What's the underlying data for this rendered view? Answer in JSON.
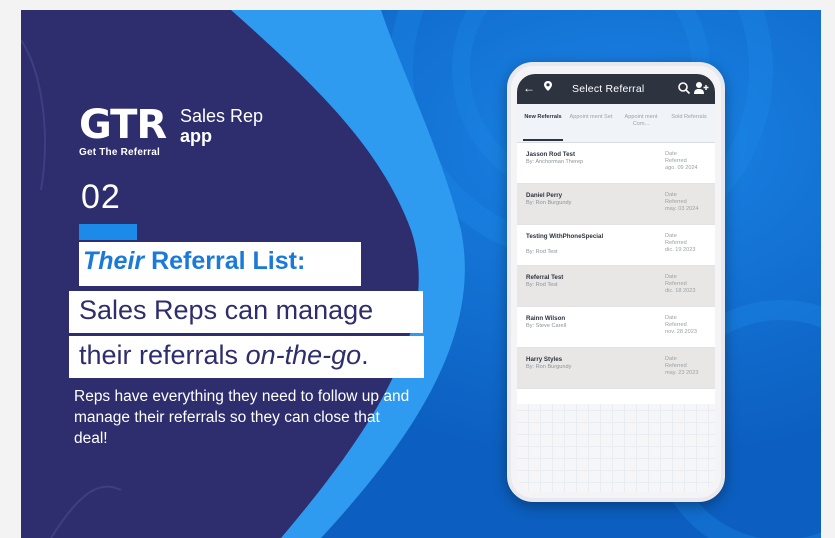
{
  "logo": {
    "mark": "GTR",
    "tagline": "Get The Referral"
  },
  "app_title": {
    "line1": "Sales Rep",
    "line2": "app"
  },
  "feature_number": "02",
  "headline": {
    "line1_italic": "Their",
    "line1_rest": " Referral List:",
    "line2": "Sales Reps can manage",
    "line3_start": "their referrals ",
    "line3_italic": "on-the-go",
    "line3_end": "."
  },
  "description": "Reps have everything they need to follow up and manage their referrals so they can close that deal!",
  "phone": {
    "title": "Select Referral",
    "tabs": [
      {
        "label": "New Referrals",
        "active": true
      },
      {
        "label": "Appoint ment Set",
        "active": false
      },
      {
        "label": "Appoint ment Com...",
        "active": false
      },
      {
        "label": "Sold Referrals",
        "active": false
      }
    ],
    "date_label": "Date",
    "date_sublabel": "Referred",
    "referrals": [
      {
        "name": "Jasson Rod Test",
        "by": "By: Anchorman Therep",
        "date": "ago. 09 2024"
      },
      {
        "name": "Daniel Perry",
        "by": "By: Ron Burgundy",
        "date": "may. 03 2024"
      },
      {
        "name": "Testing WithPhoneSpecial",
        "by": "By: Rod Test",
        "date": "dic. 19 2023"
      },
      {
        "name": "Referral Test",
        "by": "By: Rod Test",
        "date": "dic. 18 2023"
      },
      {
        "name": "Rainn Wilson",
        "by": "By: Steve Carell",
        "date": "nov. 28 2023"
      },
      {
        "name": "Harry Styles",
        "by": "By: Ron Burgundy",
        "date": "may. 23 2023"
      }
    ]
  },
  "colors": {
    "navy": "#2e2d6e",
    "blue": "#1173d4",
    "accent": "#1a7ad8"
  }
}
